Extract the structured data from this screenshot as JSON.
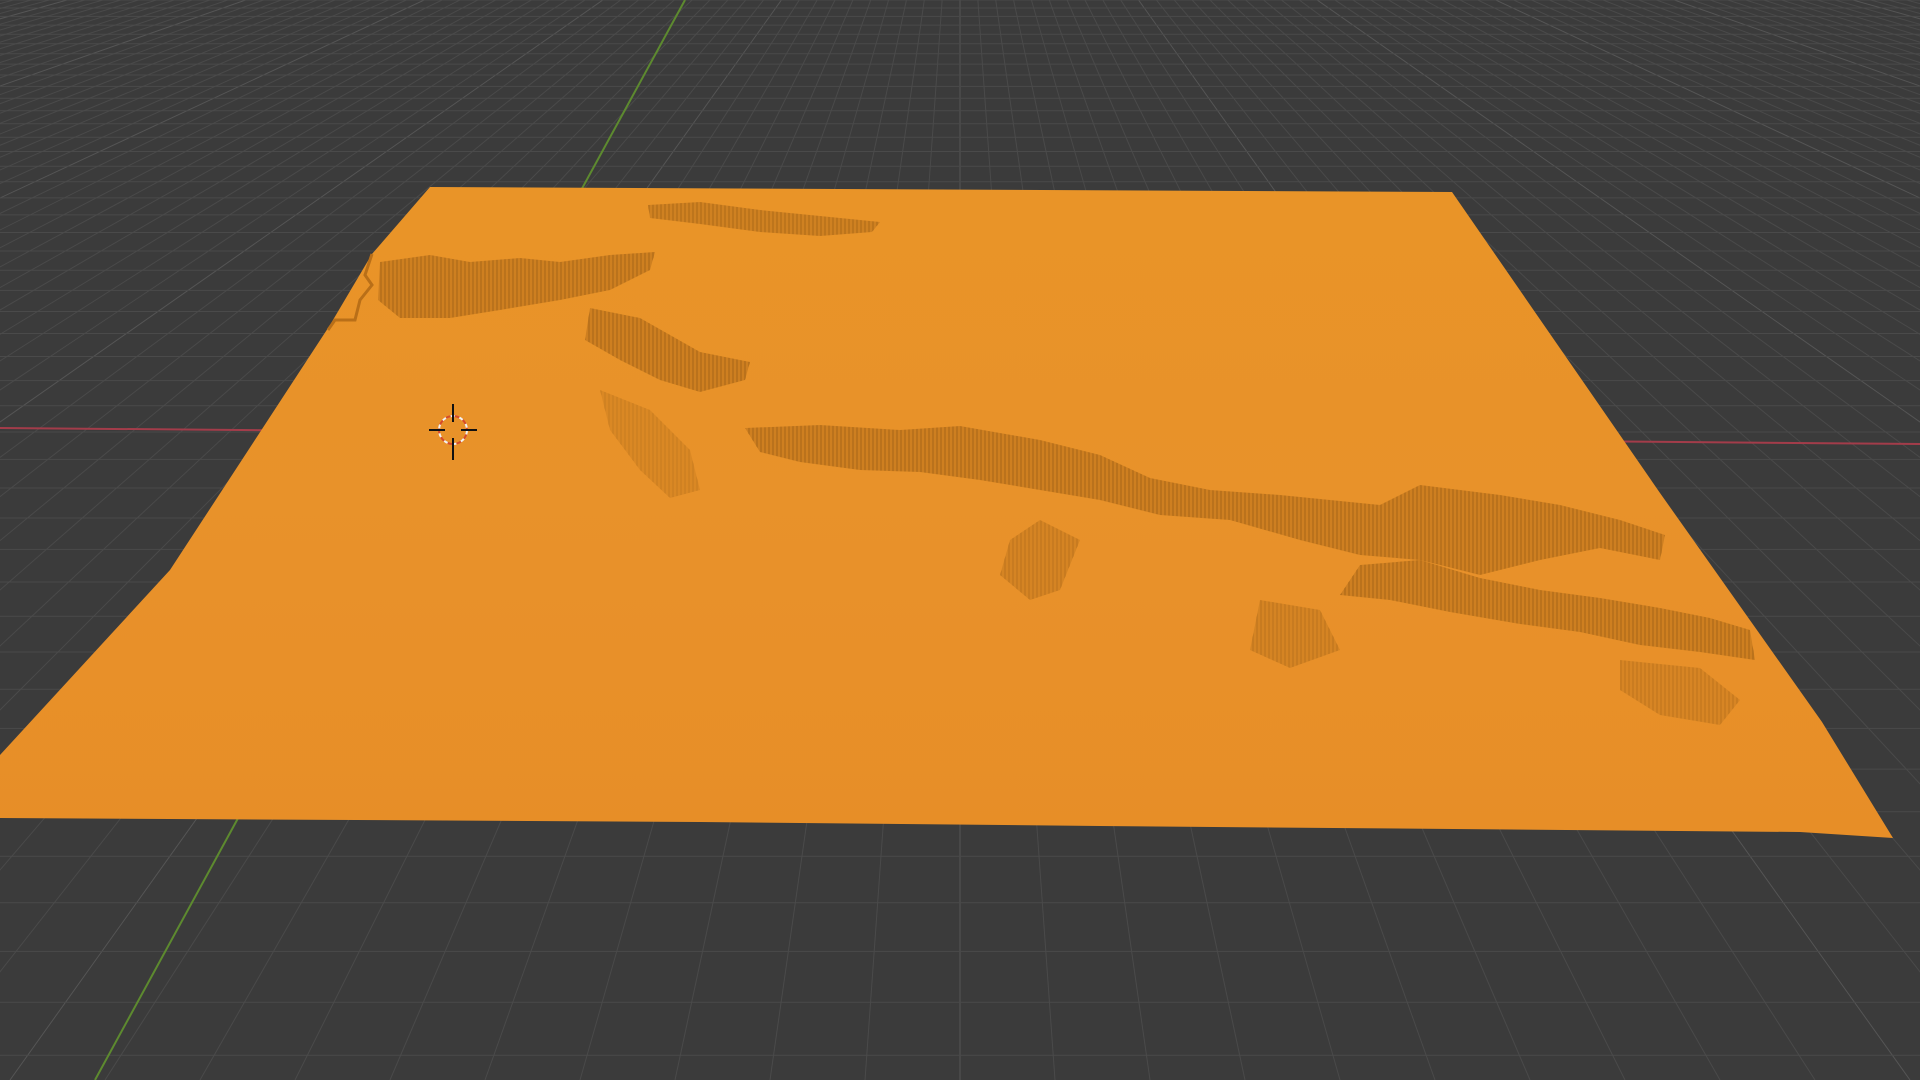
{
  "app": {
    "name": "",
    "view": "3D Viewport"
  },
  "colors": {
    "background": "#3b3b3b",
    "grid_minor": "#4a4a4a",
    "grid_major": "#555555",
    "axis_x": "#a33c4a",
    "axis_y": "#5d8a2f",
    "mesh_selected": "#e8952a",
    "mesh_shade": "#c77a1d",
    "cursor_red": "#d64a2a",
    "cursor_white": "#f2f2f2"
  },
  "scene": {
    "object": "terrain-mesh",
    "object_state": "selected",
    "cursor": "3d-cursor"
  }
}
